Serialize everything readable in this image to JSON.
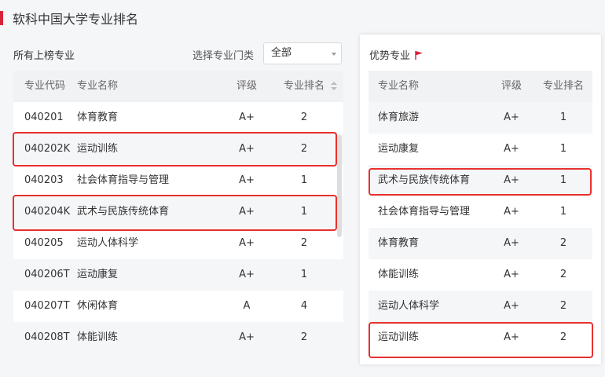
{
  "page": {
    "title": "软科中国大学专业排名"
  },
  "left": {
    "title": "所有上榜专业",
    "filter_label": "选择专业门类",
    "filter_value": "全部",
    "columns": {
      "code": "专业代码",
      "name": "专业名称",
      "grade": "评级",
      "rank": "专业排名"
    },
    "rows": [
      {
        "code": "040201",
        "name": "体育教育",
        "grade": "A+",
        "rank": "2"
      },
      {
        "code": "040202K",
        "name": "运动训练",
        "grade": "A+",
        "rank": "2"
      },
      {
        "code": "040203",
        "name": "社会体育指导与管理",
        "grade": "A+",
        "rank": "1"
      },
      {
        "code": "040204K",
        "name": "武术与民族传统体育",
        "grade": "A+",
        "rank": "1"
      },
      {
        "code": "040205",
        "name": "运动人体科学",
        "grade": "A+",
        "rank": "2"
      },
      {
        "code": "040206T",
        "name": "运动康复",
        "grade": "A+",
        "rank": "1"
      },
      {
        "code": "040207T",
        "name": "休闲体育",
        "grade": "A",
        "rank": "4"
      },
      {
        "code": "040208T",
        "name": "体能训练",
        "grade": "A+",
        "rank": "2"
      }
    ]
  },
  "right": {
    "title": "优势专业",
    "columns": {
      "name": "专业名称",
      "grade": "评级",
      "rank": "专业排名"
    },
    "rows": [
      {
        "name": "体育旅游",
        "grade": "A+",
        "rank": "1"
      },
      {
        "name": "运动康复",
        "grade": "A+",
        "rank": "1"
      },
      {
        "name": "武术与民族传统体育",
        "grade": "A+",
        "rank": "1"
      },
      {
        "name": "社会体育指导与管理",
        "grade": "A+",
        "rank": "1"
      },
      {
        "name": "体育教育",
        "grade": "A+",
        "rank": "2"
      },
      {
        "name": "体能训练",
        "grade": "A+",
        "rank": "2"
      },
      {
        "name": "运动人体科学",
        "grade": "A+",
        "rank": "2"
      },
      {
        "name": "运动训练",
        "grade": "A+",
        "rank": "2"
      }
    ]
  },
  "colors": {
    "accent": "#d8223a",
    "highlight": "#e8312f"
  },
  "icons": {
    "flag": "flag-icon",
    "sort": "sort-icon",
    "dropdown": "chevron-down-icon"
  }
}
